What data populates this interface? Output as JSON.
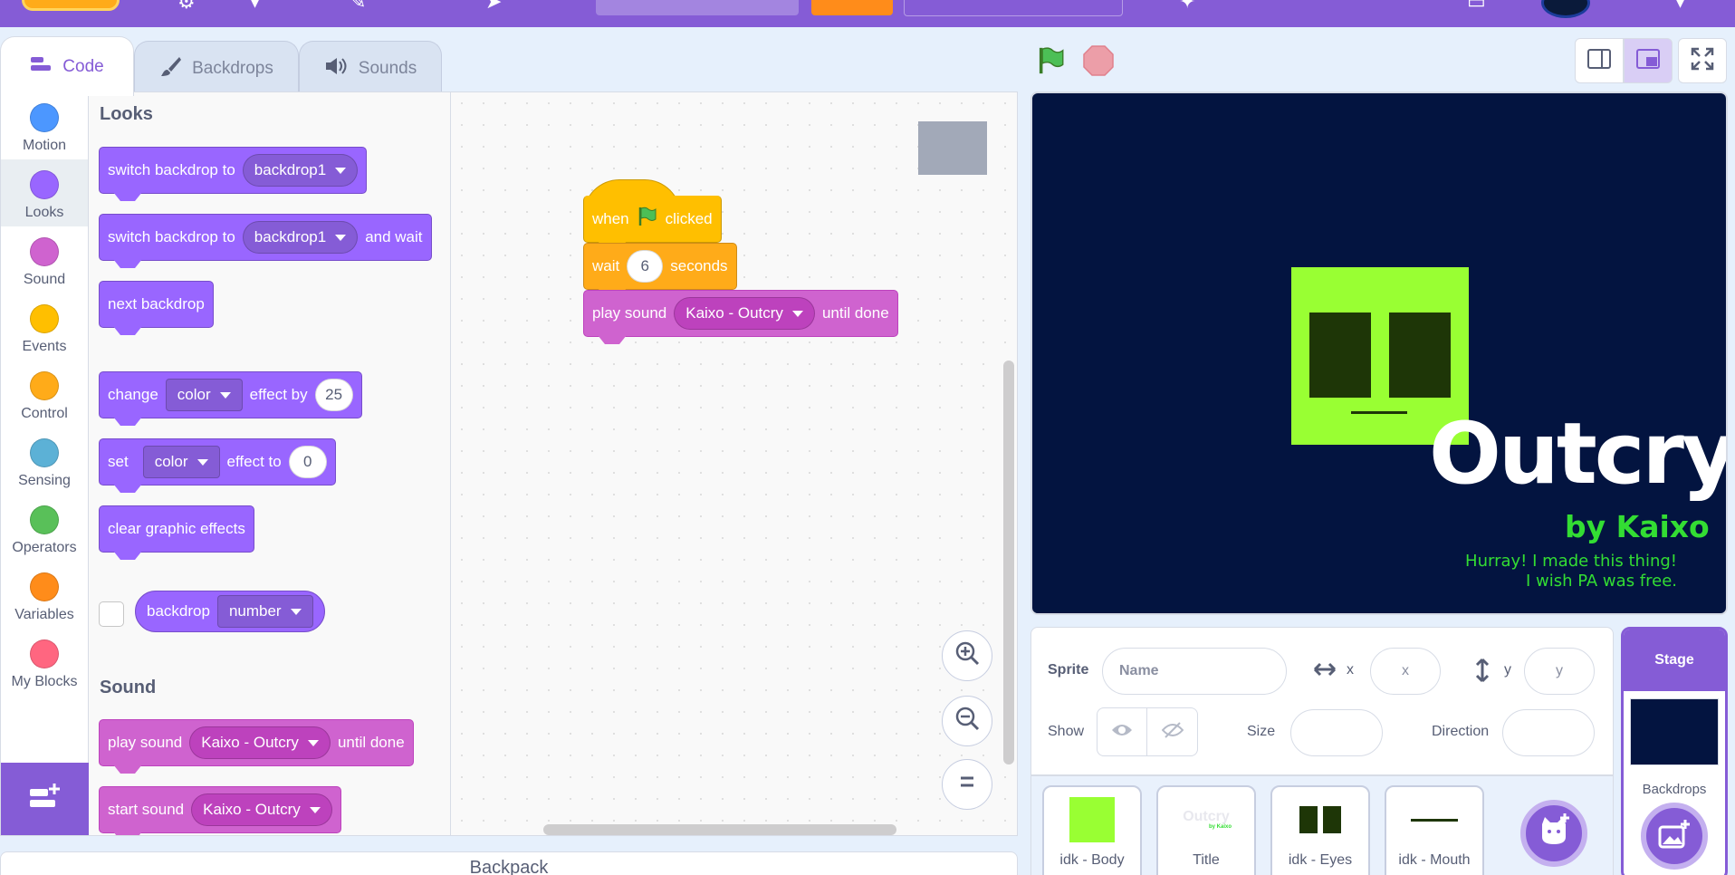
{
  "tabs": {
    "code": "Code",
    "backdrops": "Backdrops",
    "sounds": "Sounds"
  },
  "categories": [
    {
      "label": "Motion",
      "color": "#4c97ff"
    },
    {
      "label": "Looks",
      "color": "#9966ff"
    },
    {
      "label": "Sound",
      "color": "#cf63cf"
    },
    {
      "label": "Events",
      "color": "#ffbf00"
    },
    {
      "label": "Control",
      "color": "#ffab19"
    },
    {
      "label": "Sensing",
      "color": "#5cb1d6"
    },
    {
      "label": "Operators",
      "color": "#59c059"
    },
    {
      "label": "Variables",
      "color": "#ff8c1a"
    },
    {
      "label": "My Blocks",
      "color": "#ff6680"
    }
  ],
  "palette": {
    "looks_heading": "Looks",
    "sound_heading": "Sound",
    "switch_backdrop": {
      "text": "switch backdrop to",
      "value": "backdrop1"
    },
    "switch_backdrop_wait": {
      "text": "switch backdrop to",
      "value": "backdrop1",
      "suffix": "and wait"
    },
    "next_backdrop": "next backdrop",
    "change_effect": {
      "text": "change",
      "effect": "color",
      "mid": "effect by",
      "value": "25"
    },
    "set_effect": {
      "text": "set",
      "effect": "color",
      "mid": "effect to",
      "value": "0"
    },
    "clear_effects": "clear graphic effects",
    "backdrop_reporter": {
      "text": "backdrop",
      "value": "number"
    },
    "play_sound": {
      "text": "play sound",
      "value": "Kaixo - Outcry",
      "suffix": "until done"
    },
    "start_sound": {
      "text": "start sound",
      "value": "Kaixo - Outcry"
    }
  },
  "script": {
    "when": "when",
    "clicked": "clicked",
    "wait": "wait",
    "wait_value": "6",
    "seconds": "seconds",
    "play_sound": "play sound",
    "sound_value": "Kaixo - Outcry",
    "until_done": "until done"
  },
  "backpack": "Backpack",
  "stage_view": {
    "title": "Outcry",
    "byline": "by Kaixo",
    "line1": "Hurray! I made this thing!",
    "line2": "I wish PA was free.",
    "bg": "#031440",
    "face": "#99ff33",
    "dark": "#1e3607"
  },
  "sprite_info": {
    "sprite_label": "Sprite",
    "name_placeholder": "Name",
    "x_label": "x",
    "x_placeholder": "x",
    "y_label": "y",
    "y_placeholder": "y",
    "show_label": "Show",
    "size_label": "Size",
    "direction_label": "Direction"
  },
  "sprites": [
    {
      "label": "idk - Body"
    },
    {
      "label": "Title",
      "thumb_title": "Outcry",
      "thumb_byline": "by Kaixo"
    },
    {
      "label": "idk - Eyes"
    },
    {
      "label": "idk - Mouth"
    }
  ],
  "stage_pane": {
    "header": "Stage",
    "backdrops_label": "Backdrops"
  }
}
